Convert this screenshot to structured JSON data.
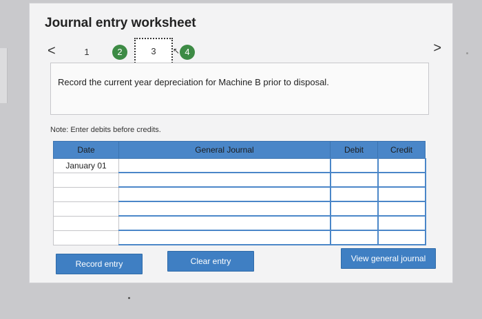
{
  "worksheet": {
    "title": "Journal entry worksheet",
    "steps": [
      "1",
      "2",
      "3",
      "4"
    ],
    "prev_symbol": "<",
    "next_symbol": ">",
    "instruction": "Record the current year depreciation for Machine B prior to disposal.",
    "note": "Note: Enter debits before credits."
  },
  "table": {
    "headers": {
      "date": "Date",
      "general_journal": "General Journal",
      "debit": "Debit",
      "credit": "Credit"
    },
    "rows": [
      {
        "date": "January 01"
      },
      {
        "date": ""
      },
      {
        "date": ""
      },
      {
        "date": ""
      },
      {
        "date": ""
      },
      {
        "date": ""
      }
    ]
  },
  "buttons": {
    "record": "Record entry",
    "clear": "Clear entry",
    "view": "View general journal"
  },
  "colors": {
    "accent": "#4a86c8",
    "step_done": "#3d8b45"
  }
}
